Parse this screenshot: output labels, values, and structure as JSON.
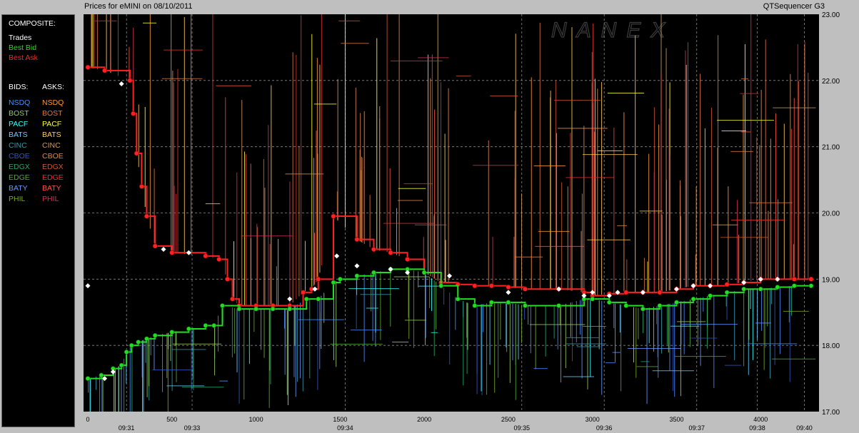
{
  "header": {
    "title": "Prices for eMINI on 08/10/2011",
    "app_name": "QTSequencer G3"
  },
  "watermark": "NANEX",
  "legend": {
    "composite_label": "COMPOSITE:",
    "composite": [
      {
        "label": "Trades",
        "color": "#ffffff"
      },
      {
        "label": "Best Bid",
        "color": "#22dd22"
      },
      {
        "label": "Best Ask",
        "color": "#ff2222"
      }
    ],
    "bids_label": "BIDS:",
    "asks_label": "ASKS:",
    "bids": [
      {
        "label": "NSDQ",
        "color": "#4a8cff"
      },
      {
        "label": "BOST",
        "color": "#99cc66"
      },
      {
        "label": "PACF",
        "color": "#33ffff"
      },
      {
        "label": "BATS",
        "color": "#66ccff"
      },
      {
        "label": "CINC",
        "color": "#3399aa"
      },
      {
        "label": "CBOE",
        "color": "#3355bb"
      },
      {
        "label": "EDGX",
        "color": "#22aa66"
      },
      {
        "label": "EDGE",
        "color": "#55aa33"
      },
      {
        "label": "BATY",
        "color": "#6699ff"
      },
      {
        "label": "PHIL",
        "color": "#77aa22"
      }
    ],
    "asks": [
      {
        "label": "NSDQ",
        "color": "#ff9933"
      },
      {
        "label": "BOST",
        "color": "#dd7744"
      },
      {
        "label": "PACF",
        "color": "#ffff33"
      },
      {
        "label": "BATS",
        "color": "#ffcc55"
      },
      {
        "label": "CINC",
        "color": "#cc9966"
      },
      {
        "label": "CBOE",
        "color": "#dd8855"
      },
      {
        "label": "EDGX",
        "color": "#cc5533"
      },
      {
        "label": "EDGE",
        "color": "#dd3333"
      },
      {
        "label": "BATY",
        "color": "#ff5544"
      },
      {
        "label": "PHIL",
        "color": "#cc3355"
      }
    ]
  },
  "chart_data": {
    "type": "line",
    "title": "Prices for eMINI on 08/10/2011",
    "ylim": [
      17.0,
      23.0
    ],
    "xlim": [
      0,
      4330
    ],
    "y_ticks": [
      "17.00",
      "18.00",
      "19.00",
      "20.00",
      "21.00",
      "22.00",
      "23.00"
    ],
    "x_ticks": [
      {
        "value": 0,
        "label": "0"
      },
      {
        "value": 500,
        "label": "500"
      },
      {
        "value": 1000,
        "label": "1000"
      },
      {
        "value": 1500,
        "label": "1500"
      },
      {
        "value": 2000,
        "label": "2000"
      },
      {
        "value": 2500,
        "label": "2500"
      },
      {
        "value": 3000,
        "label": "3000"
      },
      {
        "value": 3500,
        "label": "3500"
      },
      {
        "value": 4000,
        "label": "4000"
      }
    ],
    "time_ticks": [
      {
        "value": 230,
        "label": "09:31"
      },
      {
        "value": 620,
        "label": "09:33"
      },
      {
        "value": 1530,
        "label": "09:34"
      },
      {
        "value": 2580,
        "label": "09:35"
      },
      {
        "value": 3070,
        "label": "09:36"
      },
      {
        "value": 3620,
        "label": "09:37"
      },
      {
        "value": 3980,
        "label": "09:38"
      },
      {
        "value": 4260,
        "label": "09:40"
      }
    ],
    "grid": true,
    "series": [
      {
        "name": "Best Ask",
        "color": "#ff2222",
        "x": [
          0,
          100,
          250,
          270,
          290,
          320,
          350,
          400,
          500,
          700,
          780,
          830,
          860,
          900,
          1000,
          1100,
          1200,
          1280,
          1330,
          1370,
          1460,
          1600,
          1700,
          1800,
          1900,
          2000,
          2100,
          2200,
          2300,
          2400,
          2500,
          2600,
          2800,
          2950,
          3000,
          3100,
          3200,
          3300,
          3400,
          3500,
          3600,
          3700,
          3800,
          3900,
          4000,
          4100,
          4200,
          4300
        ],
        "y": [
          22.2,
          22.15,
          22.0,
          21.5,
          20.9,
          20.4,
          19.95,
          19.5,
          19.4,
          19.35,
          19.3,
          19.0,
          18.7,
          18.6,
          18.6,
          18.6,
          18.6,
          18.8,
          18.85,
          19.0,
          19.95,
          19.6,
          19.45,
          19.4,
          19.3,
          19.1,
          18.95,
          18.92,
          18.9,
          18.9,
          18.88,
          18.85,
          18.85,
          18.8,
          18.75,
          18.78,
          18.8,
          18.8,
          18.8,
          18.85,
          18.9,
          18.9,
          18.92,
          18.95,
          19.0,
          19.0,
          19.0,
          19.0
        ]
      },
      {
        "name": "Best Bid",
        "color": "#22dd22",
        "x": [
          0,
          80,
          150,
          200,
          230,
          260,
          300,
          350,
          400,
          500,
          600,
          700,
          750,
          800,
          900,
          1000,
          1100,
          1200,
          1300,
          1370,
          1460,
          1500,
          1600,
          1700,
          1800,
          1900,
          2000,
          2100,
          2200,
          2300,
          2400,
          2500,
          2600,
          2800,
          2950,
          3000,
          3100,
          3200,
          3300,
          3400,
          3500,
          3600,
          3700,
          3800,
          3900,
          4000,
          4100,
          4200,
          4300
        ],
        "y": [
          17.5,
          17.55,
          17.65,
          17.7,
          17.9,
          18.0,
          18.05,
          18.1,
          18.15,
          18.2,
          18.25,
          18.3,
          18.3,
          18.6,
          18.55,
          18.55,
          18.55,
          18.55,
          18.7,
          18.7,
          18.95,
          19.0,
          19.05,
          19.1,
          19.15,
          19.15,
          19.1,
          18.9,
          18.7,
          18.6,
          18.65,
          18.65,
          18.6,
          18.6,
          18.7,
          18.7,
          18.65,
          18.6,
          18.55,
          18.6,
          18.65,
          18.7,
          18.75,
          18.8,
          18.85,
          18.85,
          18.88,
          18.9,
          18.9
        ]
      },
      {
        "name": "Trades",
        "color": "#ffffff",
        "x": [
          0,
          100,
          150,
          200,
          450,
          600,
          1200,
          1350,
          1480,
          1600,
          1800,
          1900,
          2150,
          2500,
          2800,
          2950,
          3000,
          3100,
          3150,
          3300,
          3500,
          3600,
          3700,
          3900,
          4000,
          4100
        ],
        "y": [
          18.9,
          17.5,
          17.6,
          21.95,
          19.45,
          19.4,
          18.7,
          18.85,
          19.35,
          19.2,
          19.15,
          19.1,
          19.05,
          18.8,
          18.85,
          18.75,
          18.8,
          18.75,
          18.8,
          18.8,
          18.85,
          18.9,
          18.9,
          18.95,
          19.0,
          19.0
        ]
      }
    ]
  }
}
